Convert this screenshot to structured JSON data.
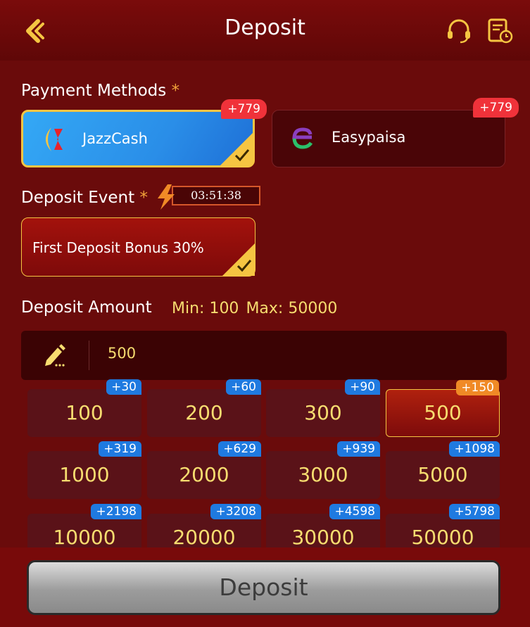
{
  "header": {
    "title": "Deposit",
    "back_icon": "back-arrow-icon",
    "support_icon": "headset-icon",
    "history_icon": "history-icon"
  },
  "payment": {
    "label": "Payment Methods",
    "required": "*",
    "methods": [
      {
        "name": "JazzCash",
        "badge": "+779",
        "selected": true,
        "icon": "jazzcash-logo-icon"
      },
      {
        "name": "Easypaisa",
        "badge": "+779",
        "selected": false,
        "icon": "easypaisa-logo-icon"
      }
    ]
  },
  "event": {
    "label": "Deposit Event",
    "required": "*",
    "timer": "03:51:38",
    "option": "First Deposit Bonus 30%"
  },
  "amount": {
    "label": "Deposit Amount",
    "min": "Min: 100",
    "max": "Max: 50000",
    "value": "500",
    "options": [
      {
        "value": "100",
        "bonus": "+30"
      },
      {
        "value": "200",
        "bonus": "+60"
      },
      {
        "value": "300",
        "bonus": "+90"
      },
      {
        "value": "500",
        "bonus": "+150",
        "active": true
      },
      {
        "value": "1000",
        "bonus": "+319"
      },
      {
        "value": "2000",
        "bonus": "+629"
      },
      {
        "value": "3000",
        "bonus": "+939"
      },
      {
        "value": "5000",
        "bonus": "+1098"
      },
      {
        "value": "10000",
        "bonus": "+2198"
      },
      {
        "value": "20000",
        "bonus": "+3208"
      },
      {
        "value": "30000",
        "bonus": "+4598"
      },
      {
        "value": "50000",
        "bonus": "+5798"
      }
    ]
  },
  "footer": {
    "deposit_label": "Deposit"
  },
  "colors": {
    "background": "#6a0b0b",
    "accent_gold": "#f5c542",
    "amount_text": "#f7dd70",
    "badge_red": "#f0323a",
    "badge_blue": "#1f7ae0",
    "badge_orange": "#f08a26"
  }
}
